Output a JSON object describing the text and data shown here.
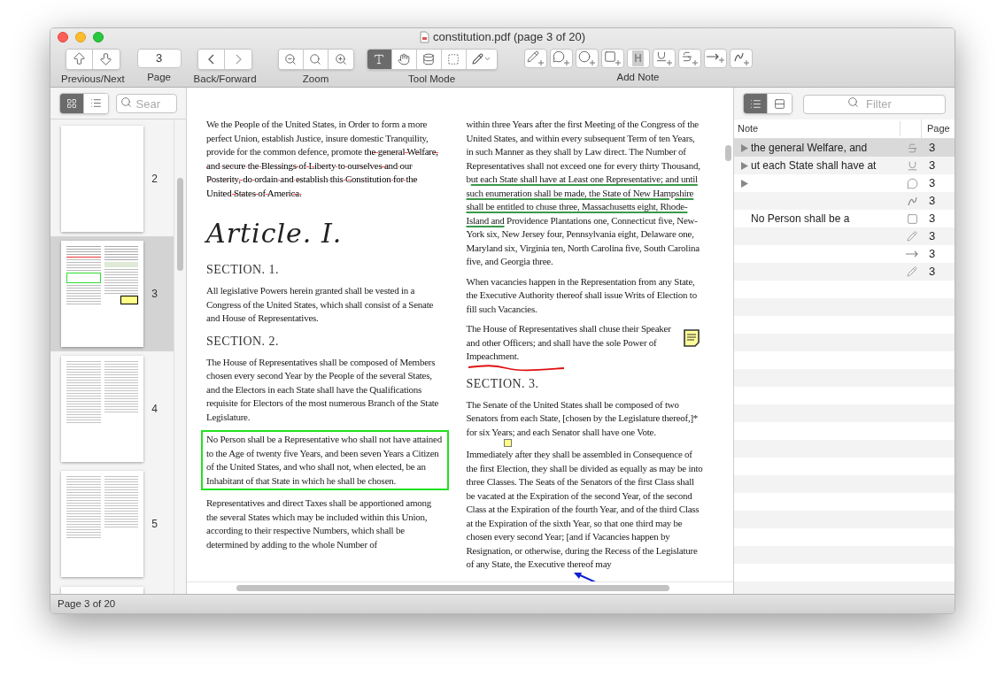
{
  "window": {
    "title": "constitution.pdf (page 3 of 20)"
  },
  "toolbar": {
    "prev_next": {
      "label": "Previous/Next"
    },
    "page": {
      "value": "3",
      "label": "Page"
    },
    "back_forward": {
      "label": "Back/Forward"
    },
    "zoom": {
      "label": "Zoom"
    },
    "tool_mode": {
      "label": "Tool Mode",
      "tools": [
        {
          "selected": true
        },
        {
          "selected": false
        },
        {
          "selected": false
        },
        {
          "selected": false
        },
        {
          "selected": false
        }
      ]
    },
    "add_note": {
      "label": "Add Note",
      "highlight_glyph": "H"
    }
  },
  "sidebar": {
    "view_modes": [
      {
        "selected": true
      },
      {
        "selected": false
      }
    ],
    "search": {
      "placeholder": "Sear"
    },
    "thumbnails": [
      {
        "page": "2",
        "selected": false,
        "kind": "blank"
      },
      {
        "page": "3",
        "selected": true,
        "kind": "annotated"
      },
      {
        "page": "4",
        "selected": false,
        "kind": "text"
      },
      {
        "page": "5",
        "selected": false,
        "kind": "text"
      }
    ]
  },
  "document": {
    "columns": [
      [
        {
          "kind": "para",
          "spans": [
            {
              "text": "We the People of the United States, in Order to form a more perfect Union, establish Justice, insure domestic Tranquility, provide for the common defence, promote ",
              "struck": false,
              "underlined": false
            },
            {
              "text": "the general Welfare, and secure the Blessings of Liberty to ourselves and our Posterity, do ordain and establish this Constitution for the United States of America.",
              "struck": true,
              "underlined": false
            }
          ]
        },
        {
          "kind": "article",
          "text": "Article. I."
        },
        {
          "kind": "heading",
          "text": "SECTION. 1."
        },
        {
          "kind": "para",
          "spans": [
            {
              "text": "All legislative Powers herein granted shall be vested in a Congress of the United States, which shall consist of a Senate and House of Representatives.",
              "struck": false,
              "underlined": false
            }
          ]
        },
        {
          "kind": "heading",
          "text": "SECTION. 2."
        },
        {
          "kind": "para",
          "spans": [
            {
              "text": "The House of Representatives shall be composed of Members chosen every second Year by the People of the several States, and the Electors in each State shall have the Qualifications requisite for Electors of the most numerous Branch of the State Legislature.",
              "struck": false,
              "underlined": false
            }
          ]
        },
        {
          "kind": "para",
          "boxed": true,
          "spans": [
            {
              "text": "No Person shall be a Representative who shall not have attained to the Age of twenty five Years, and been seven Years a Citizen of the United States, and who shall not, when elected, be an Inhabitant of that State in which he shall be chosen.",
              "struck": false,
              "underlined": false
            }
          ]
        },
        {
          "kind": "para",
          "spans": [
            {
              "text": "Representatives and direct Taxes shall be apportioned among the several States which may be included within this Union, according to their respective Numbers, which shall be determined by adding to the whole Number of",
              "struck": false,
              "underlined": false
            }
          ]
        }
      ],
      [
        {
          "kind": "para",
          "spans": [
            {
              "text": "within three Years after the first Meeting of the Congress of the United States, and within every subsequent Term of ten Years, in such Manner as they shall by Law direct. The Number of Representatives shall not exceed one for every thirty Thousand, b",
              "struck": false,
              "underlined": false
            },
            {
              "text": "ut each State shall have at Least one Representative; and until such enumeration shall be made, the State of New Hampshire shall be entitled to chuse three, Massachusetts eight, Rhode-Island and",
              "struck": false,
              "underlined": true
            },
            {
              "text": " Providence Plantations one, Connecticut five, New-York six, New Jersey four, Pennsylvania eight, Delaware one, Maryland six, Virginia ten, North Carolina five, South Carolina five, and Georgia three.",
              "struck": false,
              "underlined": false
            }
          ]
        },
        {
          "kind": "para",
          "spans": [
            {
              "text": "When vacancies happen in the Representation from any State, the Executive Authority thereof shall issue Writs of Election to fill such Vacancies.",
              "struck": false,
              "underlined": false
            }
          ]
        },
        {
          "kind": "para",
          "note": true,
          "freehand": true,
          "spans": [
            {
              "text": "The House of Representatives shall chuse their Speaker and other Officers; and shall have the sole Power of Impeachment.",
              "struck": false,
              "underlined": false
            }
          ]
        },
        {
          "kind": "heading",
          "text": "SECTION. 3."
        },
        {
          "kind": "para",
          "spans": [
            {
              "text": "The Senate of the United States shall be composed of two Senators from each State, [chosen by the Legislature thereof,]* for six Years; and each Senator shall have one Vote.",
              "struck": false,
              "underlined": false
            }
          ]
        },
        {
          "kind": "para",
          "marker": true,
          "spans": [
            {
              "text": "Immediately after they shall be assembled in Consequence of the first Election, they shall be divided as equally as may be into three Classes. The Seats of the Senators of the first Class shall be vacated at the Expiration of the second Year, of the second Class at the Expiration of the fourth Year, and of the third Class at the Expiration of the sixth Year, so that one third may be chosen every second Year; [and if Vacancies happen by Resignation, or otherwise, during the Recess of the Legislature of any State, the Executive thereof may",
              "struck": false,
              "underlined": false
            }
          ]
        }
      ]
    ]
  },
  "notes": {
    "view_modes": [
      {
        "selected": true
      },
      {
        "selected": false
      }
    ],
    "filter": {
      "placeholder": "Filter"
    },
    "columns": [
      "Note",
      "Page"
    ],
    "rows": [
      {
        "note": "the general Welfare, and",
        "kind": "strike",
        "page": "3",
        "expandable": true,
        "selected": true
      },
      {
        "note": "ut each State shall have at",
        "kind": "underline",
        "page": "3",
        "expandable": true,
        "selected": false
      },
      {
        "kind": "comment",
        "page": "3",
        "expandable": true,
        "selected": false
      },
      {
        "kind": "freehand",
        "page": "3",
        "expandable": false,
        "selected": false
      },
      {
        "note": "No Person shall be a",
        "kind": "box",
        "page": "3",
        "expandable": false,
        "selected": false
      },
      {
        "kind": "pencil",
        "page": "3",
        "expandable": false,
        "selected": false
      },
      {
        "kind": "arrow",
        "page": "3",
        "expandable": false,
        "selected": false
      },
      {
        "kind": "pencil",
        "page": "3",
        "expandable": false,
        "selected": false
      }
    ]
  },
  "status_bar": {
    "text": "Page 3 of 20"
  }
}
